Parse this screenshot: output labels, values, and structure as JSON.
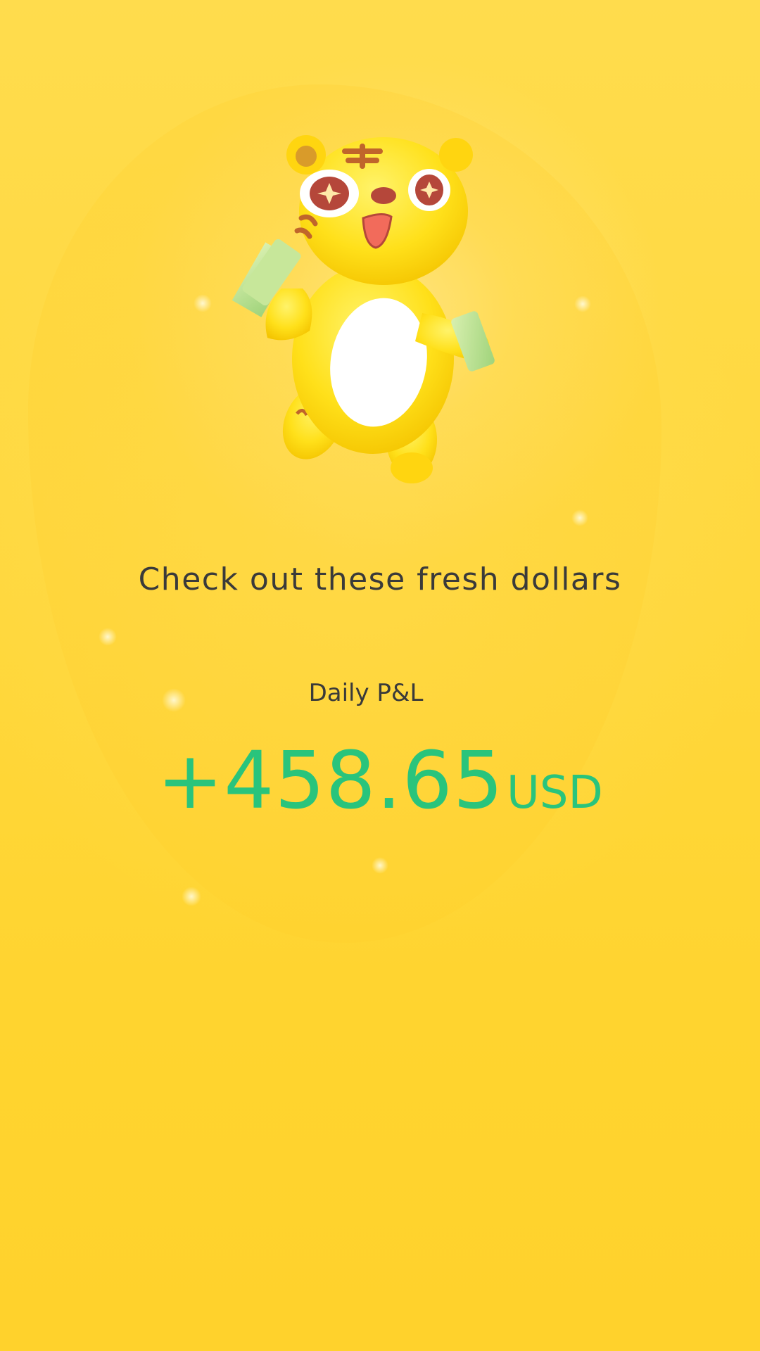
{
  "headline": "Check out these fresh dollars",
  "daily_pl": {
    "label": "Daily P&L",
    "value": "+458.65",
    "currency": "USD"
  },
  "mascot": {
    "icon": "tiger-mascot-holding-cash-icon"
  },
  "colors": {
    "background": "#ffd83e",
    "headline_text": "#3a3a3a",
    "profit_green": "#29c47c"
  }
}
